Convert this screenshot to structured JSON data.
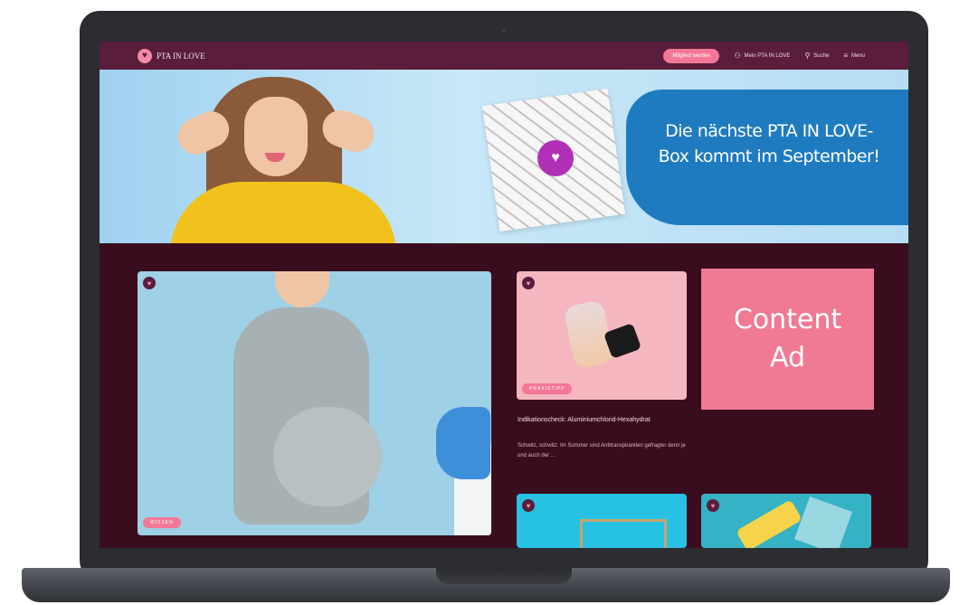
{
  "nav": {
    "logo_text": "PTA IN LOVE",
    "pill_label": "Mitglied werden",
    "links": [
      {
        "icon": "user-icon",
        "label": "Mein PTA IN LOVE"
      },
      {
        "icon": "search-icon",
        "label": "Suche"
      },
      {
        "icon": "menu-icon",
        "label": "Menu"
      }
    ]
  },
  "hero": {
    "headline_line1": "Die nächste PTA IN LOVE-",
    "headline_line2": "Box kommt im September!"
  },
  "feature": {
    "tag": "WISSEN"
  },
  "card1": {
    "tag": "PRAXISTIPP",
    "title": "Indikationscheck: Aluminiumchlorid-Hexahydrat",
    "desc": "Schwitz, schwitz: Im Sommer sind Antitranspirantien gefragter denn je und auch der ..."
  },
  "ad": {
    "line1": "Content",
    "line2": "Ad"
  },
  "colors": {
    "accent": "#f37796",
    "background": "#3a0d1e",
    "nav": "#5a1e3c"
  }
}
